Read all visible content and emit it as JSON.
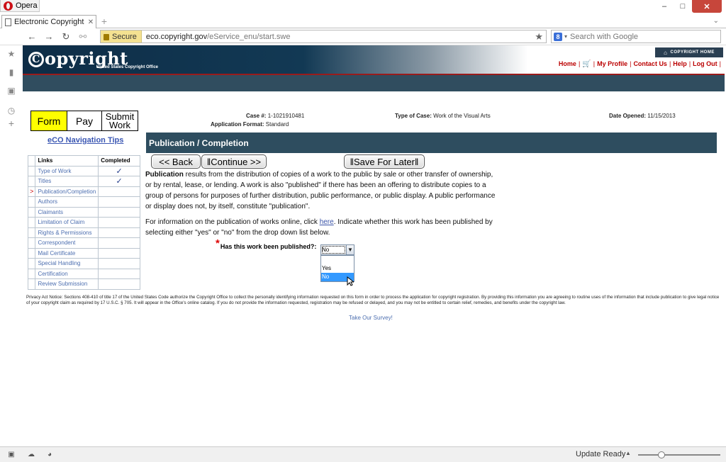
{
  "browser": {
    "menu_label": "Opera",
    "tab_title": "Electronic Copyright O...",
    "secure_label": "Secure",
    "url_domain": "eco.copyright.gov",
    "url_prefix": "",
    "url_path": "/eService_enu/start.swe",
    "search_placeholder": "Search with Google",
    "status_text": "Update Ready"
  },
  "site": {
    "logo_text": "opyright",
    "logo_sub": "United States Copyright Office",
    "home_button": "COPYRIGHT HOME",
    "links": [
      "Home",
      "My Profile",
      "Contact Us",
      "Help",
      "Log Out"
    ]
  },
  "steps": {
    "form": "Form",
    "pay": "Pay",
    "submit_line1": "Submit",
    "submit_line2": "Work"
  },
  "nav_tips": "eCO Navigation Tips",
  "links_table": {
    "headers": {
      "links": "Links",
      "completed": "Completed"
    },
    "rows": [
      {
        "label": "Type of Work",
        "done": "✓"
      },
      {
        "label": "Titles",
        "done": "✓"
      },
      {
        "label": "Publication/Completion",
        "done": ""
      },
      {
        "label": "Authors",
        "done": ""
      },
      {
        "label": "Claimants",
        "done": ""
      },
      {
        "label": "Limitation of Claim",
        "done": ""
      },
      {
        "label": "Rights & Permissions",
        "done": ""
      },
      {
        "label": "Correspondent",
        "done": ""
      },
      {
        "label": "Mail Certificate",
        "done": ""
      },
      {
        "label": "Special Handling",
        "done": ""
      },
      {
        "label": "Certification",
        "done": ""
      },
      {
        "label": "Review Submission",
        "done": ""
      }
    ],
    "current_marker": ">"
  },
  "case": {
    "case_label": "Case #:",
    "case_value": "1-1021910481",
    "format_label": "Application Format:",
    "format_value": "Standard",
    "type_label": "Type of Case:",
    "type_value": "Work of the Visual Arts",
    "date_label": "Date Opened:",
    "date_value": "11/15/2013"
  },
  "section_title": "Publication / Completion",
  "buttons": {
    "back": "<< Back",
    "continue": "Continue >>",
    "save": "Save For Later"
  },
  "body": {
    "para1_bold": "Publication",
    "para1_rest": " results from the distribution of copies of a work to the public by sale or other transfer of ownership, or by rental, lease, or lending. A work is also \"published\" if there has been an offering to distribute copies to a group of persons for purposes of further distribution, public performance, or public display. A public performance or display does not, by itself, constitute \"publication\".",
    "para2_before": "For information on the publication of works online, click ",
    "para2_link": "here",
    "para2_after": ". Indicate whether this work has been published by selecting either \"yes\" or \"no\" from the drop down list below."
  },
  "question": {
    "required_mark": "*",
    "label": "Has this work been published?:",
    "selected": "No",
    "options": [
      "",
      "Yes",
      "No"
    ]
  },
  "privacy_notice": "Privacy Act Notice: Sections 408-410 of title 17 of the United States Code authorize the Copyright Office to collect the personally identifying information requested on this form in order to process the application for copyright registration. By providing this information you are agreeing to routine uses of the information that include publication to give legal notice of your copyright claim as required by 17 U.S.C. § 705. It will appear in the Office's online catalog. If you do not provide the information requested, registration may be refused or delayed, and you may not be entitled to certain relief, remedies, and benefits under the copyright law.",
  "survey_link": "Take Our Survey!"
}
